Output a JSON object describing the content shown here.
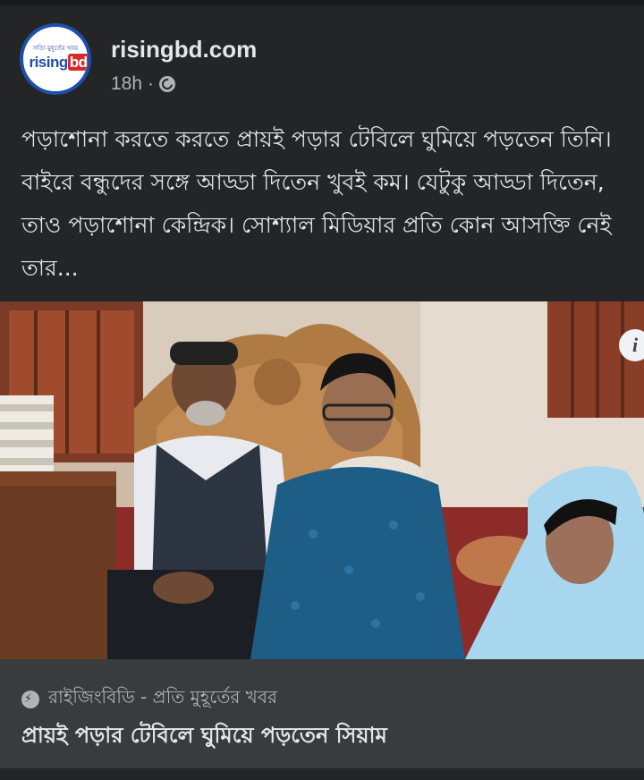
{
  "post": {
    "page_name": "risingbd.com",
    "time": "18h",
    "separator": "·",
    "audience_icon": "globe-icon",
    "avatar": {
      "tagline": "সত্যি মুহূর্তের খবর",
      "logo_text": "risingbd",
      "logo_main": "rising",
      "logo_accent": "bd"
    },
    "text": "পড়াশোনা করতে করতে প্রায়ই পড়ার টেবিলে ঘুমিয়ে পড়তেন তিনি। বাইরে বন্ধুদের সঙ্গে আড্ডা দিতেন খুবই কম। যেটুকু আড্ডা দিতেন, তাও পড়াশোনা কেন্দ্রিক। সোশ্যাল মিডিয়ার প্রতি কোন আসক্তি নেই তার..."
  },
  "link_preview": {
    "source_icon": "bolt-icon",
    "source": "রাইজিংবিডি - প্রতি মুহূর্তের খবর",
    "headline": "প্রায়ই পড়ার টেবিলে ঘুমিয়ে পড়তেন সিয়াম",
    "info_icon_label": "i"
  },
  "colors": {
    "background": "#242526",
    "card": "#3a3b3c",
    "text_primary": "#e4e6eb",
    "text_secondary": "#b0b3b8",
    "brand_blue": "#1f4fa8",
    "brand_red": "#d62b2b"
  }
}
